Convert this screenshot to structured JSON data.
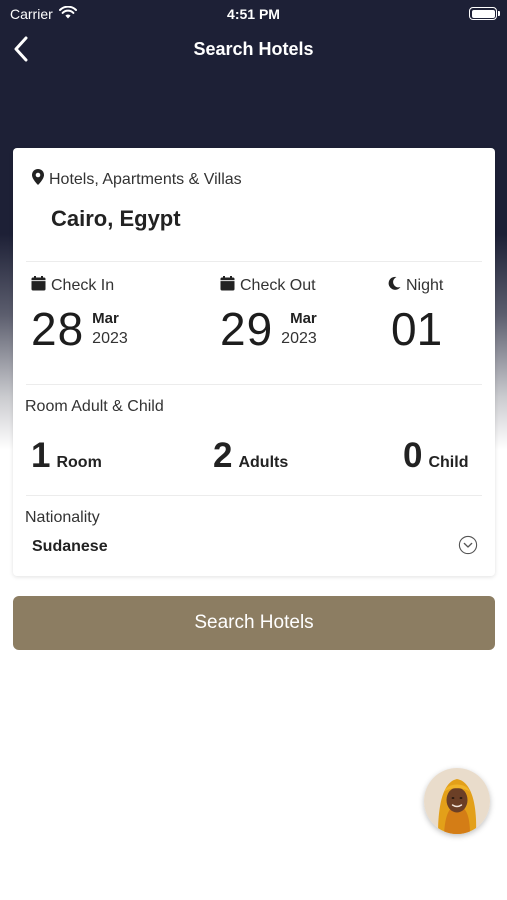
{
  "status_bar": {
    "carrier": "Carrier",
    "time": "4:51 PM"
  },
  "nav": {
    "title": "Search Hotels",
    "back_icon": "chevron-left-icon"
  },
  "destination": {
    "type_label": "Hotels, Apartments & Villas",
    "city": "Cairo, Egypt",
    "icon": "map-pin-icon"
  },
  "dates": {
    "check_in": {
      "label": "Check In",
      "day": "28",
      "month": "Mar",
      "year": "2023",
      "icon": "calendar-icon"
    },
    "check_out": {
      "label": "Check Out",
      "day": "29",
      "month": "Mar",
      "year": "2023",
      "icon": "calendar-icon"
    },
    "night": {
      "label": "Night",
      "value": "01",
      "icon": "moon-icon"
    }
  },
  "occupancy": {
    "label": "Room Adult & Child",
    "rooms": {
      "count": "1",
      "unit": "Room"
    },
    "adults": {
      "count": "2",
      "unit": "Adults"
    },
    "children": {
      "count": "0",
      "unit": "Child"
    }
  },
  "nationality": {
    "label": "Nationality",
    "value": "Sudanese",
    "icon": "chevron-down-circle-icon"
  },
  "search_button": {
    "label": "Search Hotels"
  },
  "colors": {
    "header": "#1d2036",
    "accent": "#8c7d62"
  }
}
